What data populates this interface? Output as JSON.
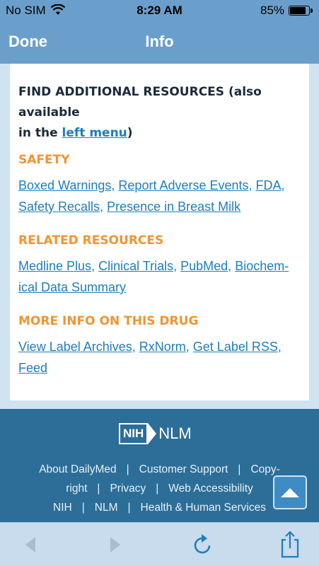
{
  "status_bar": {
    "carrier": "No SIM",
    "time": "8:29 AM",
    "battery_percent": "85%",
    "battery_level": 0.85
  },
  "nav": {
    "done_label": "Done",
    "title": "Info"
  },
  "content": {
    "heading_prefix": "FIND ADDITIONAL RESOURCES",
    "heading_suffix_1": " (also available",
    "heading_suffix_2": "in the ",
    "heading_link": "left menu",
    "heading_close": ")",
    "sections": [
      {
        "title": "SAFETY",
        "link_lines": [
          [
            "Boxed Warnings",
            "Report Adverse Events",
            "FDA"
          ],
          [
            "Safety Recalls",
            "Presence in Breast Milk"
          ]
        ]
      },
      {
        "title": "RELATED RESOURCES",
        "link_lines": [
          [
            "Medline Plus",
            "Clinical Trials",
            "PubMed",
            "Biochem-"
          ],
          [
            "ical Data Summary"
          ]
        ]
      },
      {
        "title": "MORE INFO ON THIS DRUG",
        "link_lines": [
          [
            "View Label Archives",
            "RxNorm",
            "Get Label RSS"
          ],
          [
            "Feed"
          ]
        ]
      }
    ]
  },
  "footer": {
    "logo_nih": "NIH",
    "logo_nlm": "NLM",
    "line1": [
      "About DailyMed",
      "Customer Support",
      "Copy-"
    ],
    "line2": [
      "right",
      "Privacy",
      "Web Accessibility"
    ],
    "line3": [
      "NIH",
      "NLM",
      "Health & Human Services"
    ]
  },
  "toolbar": {
    "icons": [
      "back-arrow-icon",
      "forward-arrow-icon",
      "reload-icon",
      "share-icon"
    ]
  },
  "colors": {
    "nav_bg": "#6b9fcb",
    "link": "#1f7dbd",
    "section_title": "#f29431",
    "footer_bg": "#2c6e98"
  }
}
